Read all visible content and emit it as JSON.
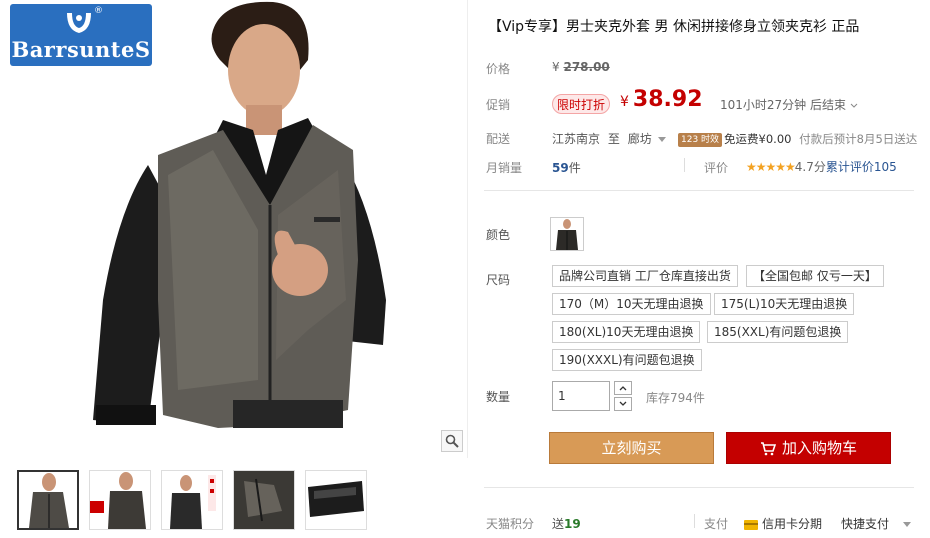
{
  "brand": {
    "name": "BarrsunteS",
    "reg_mark": "®"
  },
  "product": {
    "title": "【Vip专享】男士夹克外套 男 休闲拼接修身立领夹克衫 正品"
  },
  "price": {
    "label": "价格",
    "currency": "¥",
    "original": "278.00"
  },
  "promo": {
    "label": "促销",
    "tag": "限时打折",
    "currency": "¥",
    "price": "38.92",
    "timer": "101小时27分钟 后结束"
  },
  "shipping": {
    "label": "配送",
    "from": "江苏南京",
    "to_word": "至",
    "to": "廊坊",
    "badge": "123 时效",
    "fee": "免运费¥0.00",
    "eta": "付款后预计8月5日送达"
  },
  "sales": {
    "label": "月销量",
    "count": "59",
    "unit": "件",
    "rating_label": "评价",
    "stars": "★★★★★",
    "score": "4.7分",
    "review_text": "累计评价",
    "review_count": "105"
  },
  "color": {
    "label": "颜色"
  },
  "size": {
    "label": "尺码",
    "options": [
      "品牌公司直销 工厂仓库直接出货",
      "【全国包邮 仅亏一天】",
      "170（M）10天无理由退换",
      "175(L)10天无理由退换",
      "180(XL)10天无理由退换",
      "185(XXL)有问题包退换",
      "190(XXXL)有问题包退换"
    ]
  },
  "quantity": {
    "label": "数量",
    "value": "1",
    "stock": "库存794件"
  },
  "actions": {
    "buy_now": "立刻购买",
    "add_to_cart": "加入购物车"
  },
  "footer": {
    "points_label": "天猫积分",
    "points_prefix": "送",
    "points_value": "19",
    "payment_label": "支付",
    "credit_card": "信用卡分期",
    "quick_pay": "快捷支付"
  },
  "colors": {
    "accent_red": "#c40000",
    "buy_button": "#d89a56",
    "link_blue": "#2a5592",
    "logo_bg": "#2a6fbf"
  },
  "icons": [
    "zoom-icon",
    "chevron-down-icon",
    "cart-icon",
    "card-icon",
    "star-icon"
  ]
}
